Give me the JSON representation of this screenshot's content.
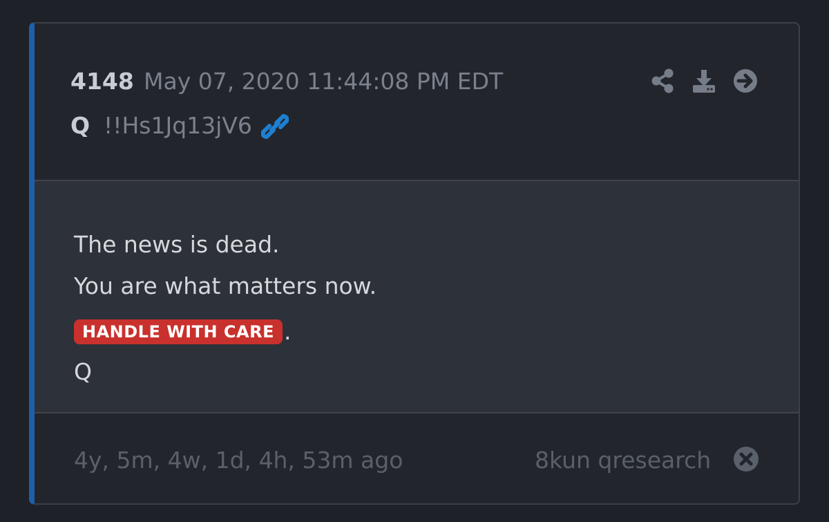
{
  "post": {
    "number": "4148",
    "date": "May 07, 2020 11:44:08 PM EDT",
    "author": "Q",
    "tripcode": "!!Hs1Jq13jV6"
  },
  "body": {
    "line1": "The news is dead.",
    "line2": "You are what matters now.",
    "tag": "HANDLE WITH CARE",
    "tag_suffix": ".",
    "signature": "Q"
  },
  "footer": {
    "age": "4y, 5m, 4w, 1d, 4h, 53m ago",
    "source": "8kun qresearch"
  },
  "icons": {
    "share": "share-icon",
    "download": "download-icon",
    "next": "arrow-right-circle-icon",
    "link": "link-icon",
    "close": "close-circle-icon"
  },
  "colors": {
    "accent_border": "#1f5fa8",
    "link": "#1e7fd0",
    "tag_background": "#c8312d"
  }
}
